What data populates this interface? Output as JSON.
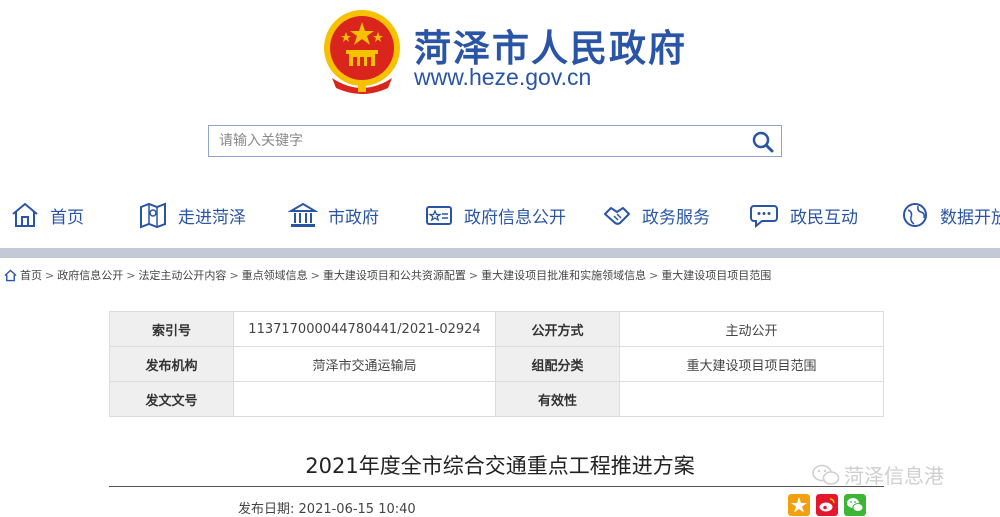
{
  "header": {
    "site_title": "菏泽市人民政府",
    "site_url": "www.heze.gov.cn"
  },
  "search": {
    "placeholder": "请输入关键字"
  },
  "nav": {
    "items": [
      {
        "label": "首页",
        "icon": "home-icon"
      },
      {
        "label": "走进菏泽",
        "icon": "map-icon"
      },
      {
        "label": "市政府",
        "icon": "government-building-icon"
      },
      {
        "label": "政府信息公开",
        "icon": "info-card-icon"
      },
      {
        "label": "政务服务",
        "icon": "handshake-icon"
      },
      {
        "label": "政民互动",
        "icon": "chat-icon"
      },
      {
        "label": "数据开放",
        "icon": "globe-icon"
      }
    ]
  },
  "breadcrumb": {
    "items": [
      "首页",
      "政府信息公开",
      "法定主动公开内容",
      "重点领域信息",
      "重大建设项目和公共资源配置",
      "重大建设项目批准和实施领域信息",
      "重大建设项目项目范围"
    ],
    "separator": ">"
  },
  "meta": {
    "index_label": "索引号",
    "index_value": "113717000044780441/2021-02924",
    "method_label": "公开方式",
    "method_value": "主动公开",
    "agency_label": "发布机构",
    "agency_value": "菏泽市交通运输局",
    "category_label": "组配分类",
    "category_value": "重大建设项目项目范围",
    "docno_label": "发文文号",
    "docno_value": "",
    "validity_label": "有效性",
    "validity_value": ""
  },
  "article": {
    "title": "2021年度全市综合交通重点工程推进方案",
    "publish_label": "发布日期:",
    "publish_date": "2021-06-15 10:40"
  },
  "watermark": {
    "text": "菏泽信息港"
  },
  "colors": {
    "brand_blue": "#2a55a6",
    "emblem_red": "#d9251c",
    "emblem_gold": "#f6c200"
  }
}
